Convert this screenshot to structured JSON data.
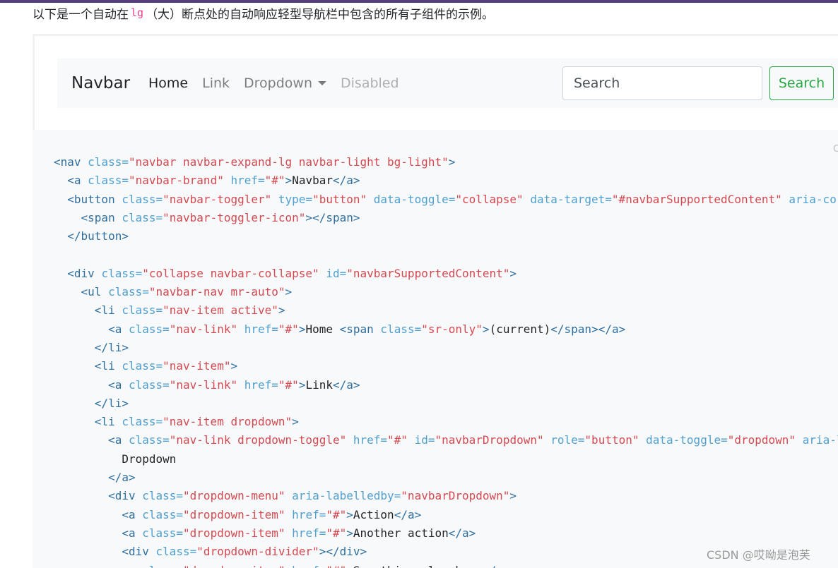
{
  "intro": {
    "prefix": "以下是一个自动在",
    "code": "lg",
    "suffix": "（大）断点处的自动响应轻型导航栏中包含的所有子组件的示例。"
  },
  "navbar": {
    "brand": "Navbar",
    "links": [
      "Home",
      "Link",
      "Dropdown",
      "Disabled"
    ],
    "search_placeholder": "Search",
    "search_button": "Search"
  },
  "copy_hint": "C",
  "code_lines": [
    [
      [
        "tag",
        "<nav "
      ],
      [
        "attr",
        "class="
      ],
      [
        "str",
        "\"navbar navbar-expand-lg navbar-light bg-light\""
      ],
      [
        "tag",
        ">"
      ]
    ],
    [
      [
        "txt",
        "  "
      ],
      [
        "tag",
        "<a "
      ],
      [
        "attr",
        "class="
      ],
      [
        "str",
        "\"navbar-brand\""
      ],
      [
        "txt",
        " "
      ],
      [
        "attr",
        "href="
      ],
      [
        "str",
        "\"#\""
      ],
      [
        "tag",
        ">"
      ],
      [
        "txt",
        "Navbar"
      ],
      [
        "tag",
        "</a>"
      ]
    ],
    [
      [
        "txt",
        "  "
      ],
      [
        "tag",
        "<button "
      ],
      [
        "attr",
        "class="
      ],
      [
        "str",
        "\"navbar-toggler\""
      ],
      [
        "txt",
        " "
      ],
      [
        "attr",
        "type="
      ],
      [
        "str",
        "\"button\""
      ],
      [
        "txt",
        " "
      ],
      [
        "attr",
        "data-toggle="
      ],
      [
        "str",
        "\"collapse\""
      ],
      [
        "txt",
        " "
      ],
      [
        "attr",
        "data-target="
      ],
      [
        "str",
        "\"#navbarSupportedContent\""
      ],
      [
        "txt",
        " "
      ],
      [
        "attr",
        "aria-co"
      ]
    ],
    [
      [
        "txt",
        "    "
      ],
      [
        "tag",
        "<span "
      ],
      [
        "attr",
        "class="
      ],
      [
        "str",
        "\"navbar-toggler-icon\""
      ],
      [
        "tag",
        "></span>"
      ]
    ],
    [
      [
        "txt",
        "  "
      ],
      [
        "tag",
        "</button>"
      ]
    ],
    [],
    [
      [
        "txt",
        "  "
      ],
      [
        "tag",
        "<div "
      ],
      [
        "attr",
        "class="
      ],
      [
        "str",
        "\"collapse navbar-collapse\""
      ],
      [
        "txt",
        " "
      ],
      [
        "attr",
        "id="
      ],
      [
        "str",
        "\"navbarSupportedContent\""
      ],
      [
        "tag",
        ">"
      ]
    ],
    [
      [
        "txt",
        "    "
      ],
      [
        "tag",
        "<ul "
      ],
      [
        "attr",
        "class="
      ],
      [
        "str",
        "\"navbar-nav mr-auto\""
      ],
      [
        "tag",
        ">"
      ]
    ],
    [
      [
        "txt",
        "      "
      ],
      [
        "tag",
        "<li "
      ],
      [
        "attr",
        "class="
      ],
      [
        "str",
        "\"nav-item active\""
      ],
      [
        "tag",
        ">"
      ]
    ],
    [
      [
        "txt",
        "        "
      ],
      [
        "tag",
        "<a "
      ],
      [
        "attr",
        "class="
      ],
      [
        "str",
        "\"nav-link\""
      ],
      [
        "txt",
        " "
      ],
      [
        "attr",
        "href="
      ],
      [
        "str",
        "\"#\""
      ],
      [
        "tag",
        ">"
      ],
      [
        "txt",
        "Home "
      ],
      [
        "tag",
        "<span "
      ],
      [
        "attr",
        "class="
      ],
      [
        "str",
        "\"sr-only\""
      ],
      [
        "tag",
        ">"
      ],
      [
        "txt",
        "(current)"
      ],
      [
        "tag",
        "</span></a>"
      ]
    ],
    [
      [
        "txt",
        "      "
      ],
      [
        "tag",
        "</li>"
      ]
    ],
    [
      [
        "txt",
        "      "
      ],
      [
        "tag",
        "<li "
      ],
      [
        "attr",
        "class="
      ],
      [
        "str",
        "\"nav-item\""
      ],
      [
        "tag",
        ">"
      ]
    ],
    [
      [
        "txt",
        "        "
      ],
      [
        "tag",
        "<a "
      ],
      [
        "attr",
        "class="
      ],
      [
        "str",
        "\"nav-link\""
      ],
      [
        "txt",
        " "
      ],
      [
        "attr",
        "href="
      ],
      [
        "str",
        "\"#\""
      ],
      [
        "tag",
        ">"
      ],
      [
        "txt",
        "Link"
      ],
      [
        "tag",
        "</a>"
      ]
    ],
    [
      [
        "txt",
        "      "
      ],
      [
        "tag",
        "</li>"
      ]
    ],
    [
      [
        "txt",
        "      "
      ],
      [
        "tag",
        "<li "
      ],
      [
        "attr",
        "class="
      ],
      [
        "str",
        "\"nav-item dropdown\""
      ],
      [
        "tag",
        ">"
      ]
    ],
    [
      [
        "txt",
        "        "
      ],
      [
        "tag",
        "<a "
      ],
      [
        "attr",
        "class="
      ],
      [
        "str",
        "\"nav-link dropdown-toggle\""
      ],
      [
        "txt",
        " "
      ],
      [
        "attr",
        "href="
      ],
      [
        "str",
        "\"#\""
      ],
      [
        "txt",
        " "
      ],
      [
        "attr",
        "id="
      ],
      [
        "str",
        "\"navbarDropdown\""
      ],
      [
        "txt",
        " "
      ],
      [
        "attr",
        "role="
      ],
      [
        "str",
        "\"button\""
      ],
      [
        "txt",
        " "
      ],
      [
        "attr",
        "data-toggle="
      ],
      [
        "str",
        "\"dropdown\""
      ],
      [
        "txt",
        " "
      ],
      [
        "attr",
        "aria-l"
      ]
    ],
    [
      [
        "txt",
        "          Dropdown"
      ]
    ],
    [
      [
        "txt",
        "        "
      ],
      [
        "tag",
        "</a>"
      ]
    ],
    [
      [
        "txt",
        "        "
      ],
      [
        "tag",
        "<div "
      ],
      [
        "attr",
        "class="
      ],
      [
        "str",
        "\"dropdown-menu\""
      ],
      [
        "txt",
        " "
      ],
      [
        "attr",
        "aria-labelledby="
      ],
      [
        "str",
        "\"navbarDropdown\""
      ],
      [
        "tag",
        ">"
      ]
    ],
    [
      [
        "txt",
        "          "
      ],
      [
        "tag",
        "<a "
      ],
      [
        "attr",
        "class="
      ],
      [
        "str",
        "\"dropdown-item\""
      ],
      [
        "txt",
        " "
      ],
      [
        "attr",
        "href="
      ],
      [
        "str",
        "\"#\""
      ],
      [
        "tag",
        ">"
      ],
      [
        "txt",
        "Action"
      ],
      [
        "tag",
        "</a>"
      ]
    ],
    [
      [
        "txt",
        "          "
      ],
      [
        "tag",
        "<a "
      ],
      [
        "attr",
        "class="
      ],
      [
        "str",
        "\"dropdown-item\""
      ],
      [
        "txt",
        " "
      ],
      [
        "attr",
        "href="
      ],
      [
        "str",
        "\"#\""
      ],
      [
        "tag",
        ">"
      ],
      [
        "txt",
        "Another action"
      ],
      [
        "tag",
        "</a>"
      ]
    ],
    [
      [
        "txt",
        "          "
      ],
      [
        "tag",
        "<div "
      ],
      [
        "attr",
        "class="
      ],
      [
        "str",
        "\"dropdown-divider\""
      ],
      [
        "tag",
        "></div>"
      ]
    ],
    [
      [
        "txt",
        "          "
      ],
      [
        "tag",
        "<a "
      ],
      [
        "attr",
        "class="
      ],
      [
        "str",
        "\"dropdown-item\""
      ],
      [
        "txt",
        " "
      ],
      [
        "attr",
        "href="
      ],
      [
        "str",
        "\"#\""
      ],
      [
        "tag",
        ">"
      ],
      [
        "txt",
        "Something else here"
      ],
      [
        "tag",
        "</a>"
      ]
    ]
  ],
  "watermark": "CSDN @哎呦是泡芙"
}
